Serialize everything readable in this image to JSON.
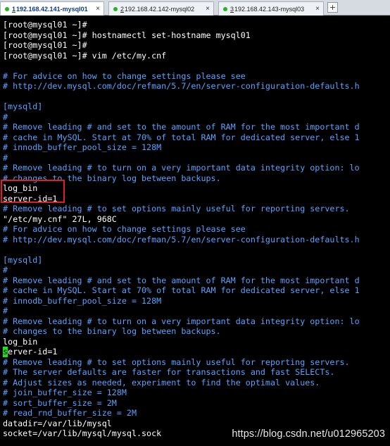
{
  "tabs": [
    {
      "num": "1",
      "label": "192.168.42.141-mysql01",
      "active": true,
      "dot_color": "#22b422",
      "close": "×"
    },
    {
      "num": "2",
      "label": "192.168.42.142-mysql02",
      "active": false,
      "dot_color": "#22b422",
      "close": "×"
    },
    {
      "num": "3",
      "label": "192.168.42.143-mysql03",
      "active": false,
      "dot_color": "#22b422",
      "close": "×"
    }
  ],
  "new_tab_label": "+",
  "colors": {
    "background": "#000000",
    "comment": "#5aa2ff",
    "text": "#ffffff",
    "cursor": "#20e020",
    "highlight_border": "#e02020"
  },
  "terminal_lines": [
    {
      "text": "[root@mysql01 ~]#",
      "style": "w"
    },
    {
      "text": "[root@mysql01 ~]# hostnamectl set-hostname mysql01",
      "style": "w"
    },
    {
      "text": "[root@mysql01 ~]#",
      "style": "w"
    },
    {
      "text": "[root@mysql01 ~]# vim /etc/my.cnf",
      "style": "w"
    },
    {
      "text": "",
      "style": "w"
    },
    {
      "text": "# For advice on how to change settings please see",
      "style": "c"
    },
    {
      "text": "# http://dev.mysql.com/doc/refman/5.7/en/server-configuration-defaults.h",
      "style": "c"
    },
    {
      "text": "",
      "style": "w"
    },
    {
      "text": "[mysqld]",
      "style": "c"
    },
    {
      "text": "#",
      "style": "c"
    },
    {
      "text": "# Remove leading # and set to the amount of RAM for the most important d",
      "style": "c"
    },
    {
      "text": "# cache in MySQL. Start at 70% of total RAM for dedicated server, else 1",
      "style": "c"
    },
    {
      "text": "# innodb_buffer_pool_size = 128M",
      "style": "c"
    },
    {
      "text": "#",
      "style": "c"
    },
    {
      "text": "# Remove leading # to turn on a very important data integrity option: lo",
      "style": "c"
    },
    {
      "text": "# changes to the binary log between backups.",
      "style": "c"
    },
    {
      "text": "log_bin",
      "style": "w"
    },
    {
      "text": "server-id=1",
      "style": "w"
    },
    {
      "text": "# Remove leading # to set options mainly useful for reporting servers.",
      "style": "c"
    },
    {
      "text": "\"/etc/my.cnf\" 27L, 968C",
      "style": "w"
    },
    {
      "text": "# For advice on how to change settings please see",
      "style": "c"
    },
    {
      "text": "# http://dev.mysql.com/doc/refman/5.7/en/server-configuration-defaults.h",
      "style": "c"
    },
    {
      "text": "",
      "style": "w"
    },
    {
      "text": "[mysqld]",
      "style": "c"
    },
    {
      "text": "#",
      "style": "c"
    },
    {
      "text": "# Remove leading # and set to the amount of RAM for the most important d",
      "style": "c"
    },
    {
      "text": "# cache in MySQL. Start at 70% of total RAM for dedicated server, else 1",
      "style": "c"
    },
    {
      "text": "# innodb_buffer_pool_size = 128M",
      "style": "c"
    },
    {
      "text": "#",
      "style": "c"
    },
    {
      "text": "# Remove leading # to turn on a very important data integrity option: lo",
      "style": "c"
    },
    {
      "text": "# changes to the binary log between backups.",
      "style": "c"
    },
    {
      "text": "log_bin",
      "style": "w"
    },
    {
      "text": "server-id=1",
      "style": "w",
      "cursor": true
    },
    {
      "text": "# Remove leading # to set options mainly useful for reporting servers.",
      "style": "c"
    },
    {
      "text": "# The server defaults are faster for transactions and fast SELECTs.",
      "style": "c"
    },
    {
      "text": "# Adjust sizes as needed, experiment to find the optimal values.",
      "style": "c"
    },
    {
      "text": "# join_buffer_size = 128M",
      "style": "c"
    },
    {
      "text": "# sort_buffer_size = 2M",
      "style": "c"
    },
    {
      "text": "# read_rnd_buffer_size = 2M",
      "style": "c"
    },
    {
      "text": "datadir=/var/lib/mysql",
      "style": "w"
    },
    {
      "text": "socket=/var/lib/mysql/mysql.sock",
      "style": "w"
    }
  ],
  "watermark": "https://blog.csdn.net/u012965203"
}
